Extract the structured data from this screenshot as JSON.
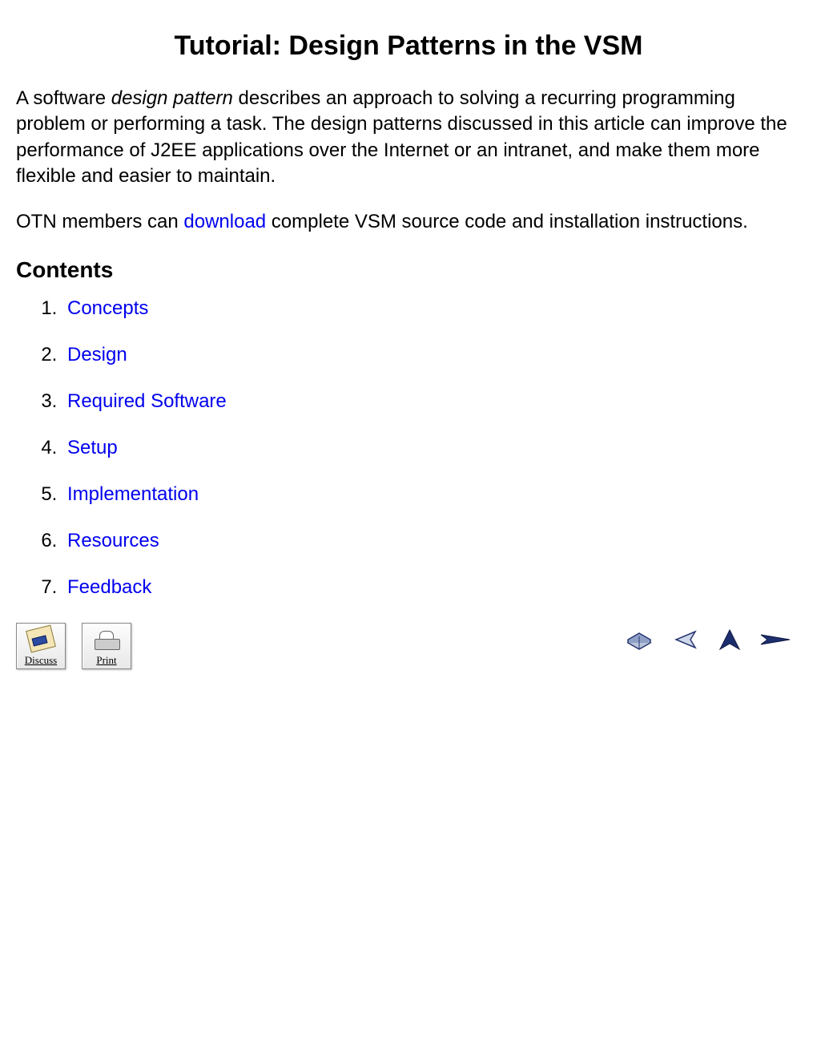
{
  "title": "Tutorial: Design Patterns in the VSM",
  "intro": {
    "pre": "A software ",
    "em": "design pattern",
    "post": " describes an approach to solving a recurring programming problem or performing a task. The design patterns discussed in this article can improve the performance of J2EE applications over the Internet or an intranet, and make them more flexible and easier to maintain."
  },
  "download_line": {
    "pre": "OTN members can ",
    "link": "download",
    "post": " complete VSM source code and installation instructions."
  },
  "contents_heading": "Contents",
  "contents": [
    "Concepts",
    "Design",
    "Required Software",
    "Setup",
    "Implementation",
    "Resources",
    "Feedback"
  ],
  "buttons": {
    "discuss": "Discuss",
    "print": "Print"
  }
}
